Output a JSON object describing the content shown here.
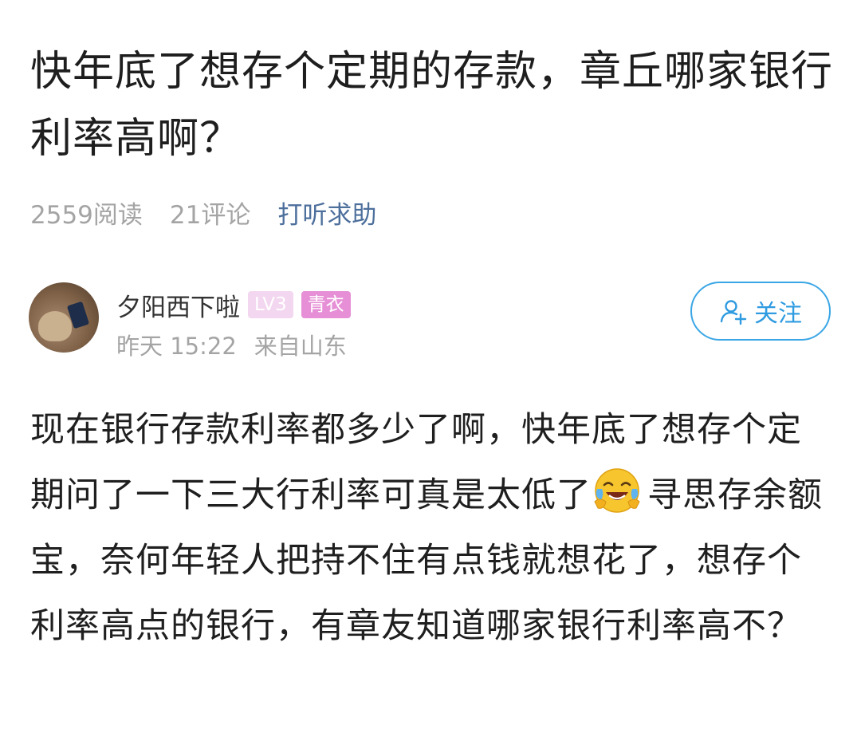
{
  "post": {
    "title": "快年底了想存个定期的存款，章丘哪家银行利率高啊？",
    "read_count": "2559阅读",
    "comment_count": "21评论",
    "category": "打听求助"
  },
  "author": {
    "name": "夕阳西下啦",
    "level_badge": "LV3",
    "rank_badge": "青衣",
    "time": "昨天 15:22",
    "location": "来自山东",
    "follow_label": "关注"
  },
  "content": {
    "text_before_emoji": "现在银行存款利率都多少了啊，快年底了想存个定期问了一下三大行利率可真是太低了",
    "emoji": "laughing-crying-emoji",
    "text_after_emoji": "寻思存余额宝，奈何年轻人把持不住有点钱就想花了，想存个利率高点的银行，有章友知道哪家银行利率高不？"
  },
  "colors": {
    "category": "#4d6f9c",
    "follow": "#2f9be0",
    "level_badge": "#f3d6ef",
    "rank_badge": "#e68fd6",
    "muted": "#a4a4a4"
  }
}
